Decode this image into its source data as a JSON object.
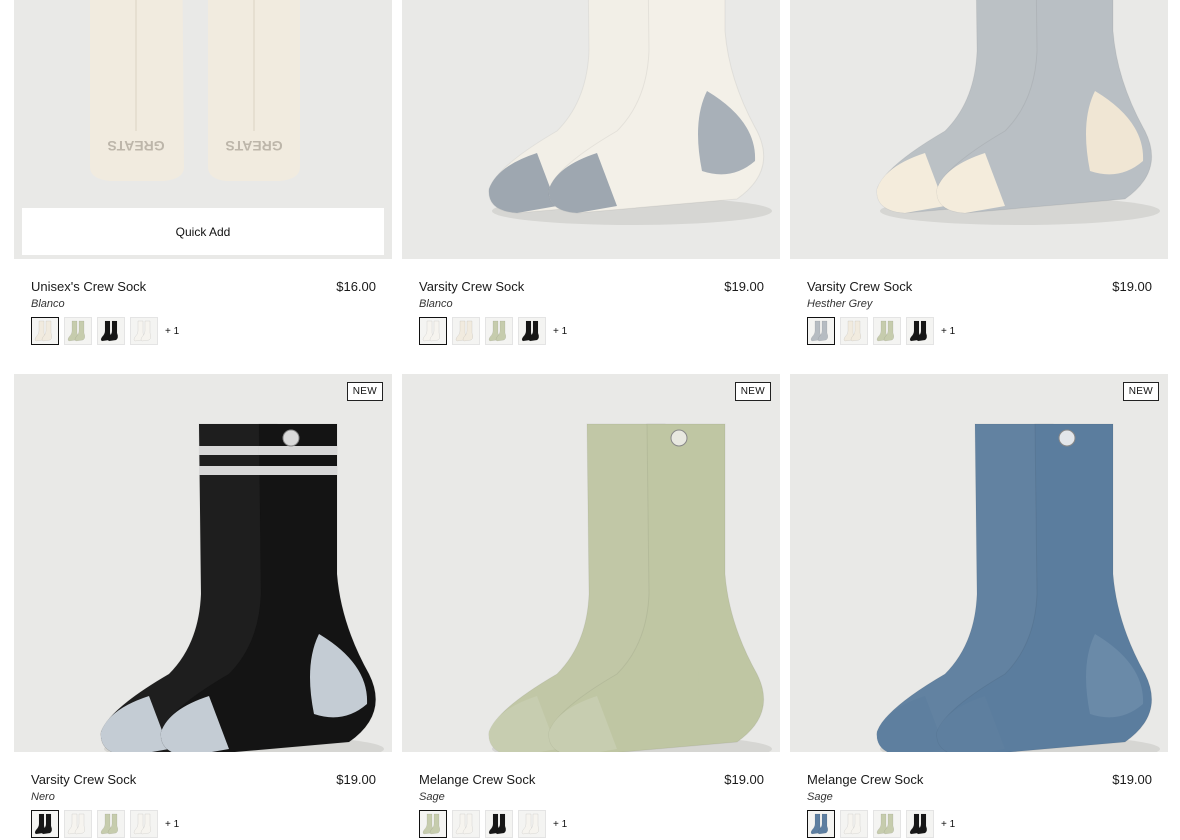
{
  "quick_add_label": "Quick Add",
  "products": [
    {
      "name": "Unisex's Crew Sock",
      "price": "$16.00",
      "variant": "Blanco",
      "badge": "",
      "swatches": [
        "cream",
        "sage",
        "black",
        "white"
      ],
      "more": "+ 1",
      "sock_style": "ankle",
      "colors": {
        "body": "#f1ebdf",
        "heel": "#f1ebdf",
        "toe": "#f1ebdf",
        "stripe": "",
        "logo": "#bdb6aa"
      },
      "logo_text": "GREATS"
    },
    {
      "name": "Varsity Crew Sock",
      "price": "$19.00",
      "variant": "Blanco",
      "badge": "",
      "swatches": [
        "white",
        "cream",
        "sage",
        "black"
      ],
      "more": "+ 1",
      "sock_style": "crew",
      "colors": {
        "body": "#f3f0e8",
        "heel": "#a8b0b8",
        "toe": "#9ea7b0",
        "stripe": "",
        "logo": "#2a3550"
      }
    },
    {
      "name": "Varsity Crew Sock",
      "price": "$19.00",
      "variant": "Hesther Grey",
      "badge": "",
      "swatches": [
        "grey",
        "cream",
        "sage",
        "black"
      ],
      "more": "+ 1",
      "sock_style": "crew",
      "colors": {
        "body": "#b9bfc4",
        "heel": "#f0e6d4",
        "toe": "#f4ecdc",
        "stripe": "",
        "logo": "#1c2740"
      }
    },
    {
      "name": "Varsity Crew Sock",
      "price": "$19.00",
      "variant": "Nero",
      "badge": "NEW",
      "swatches": [
        "black",
        "white",
        "sage",
        "white"
      ],
      "more": "+ 1",
      "sock_style": "crew",
      "colors": {
        "body": "#141414",
        "heel": "#c4ccd4",
        "toe": "#c4ccd4",
        "stripe": "#d8d8d8",
        "logo": "#d9d9d9"
      }
    },
    {
      "name": "Melange Crew Sock",
      "price": "$19.00",
      "variant": "Sage",
      "badge": "NEW",
      "swatches": [
        "sage",
        "white",
        "black",
        "white"
      ],
      "more": "+ 1",
      "sock_style": "crew",
      "colors": {
        "body": "#bfc6a3",
        "heel": "#bfc6a3",
        "toe": "#c7cdb0",
        "stripe": "",
        "logo": "#e8e8e0"
      }
    },
    {
      "name": "Melange Crew Sock",
      "price": "$19.00",
      "variant": "Sage",
      "badge": "NEW",
      "swatches": [
        "blue",
        "white",
        "sage",
        "black"
      ],
      "more": "+ 1",
      "sock_style": "crew",
      "colors": {
        "body": "#5b7d9e",
        "heel": "#6a8aa8",
        "toe": "#5e7f9f",
        "stripe": "",
        "logo": "#e3e6ea"
      }
    }
  ],
  "swatch_colors": {
    "cream": "#f1ebdf",
    "sage": "#c6ccad",
    "black": "#161616",
    "white": "#f6f4ef",
    "grey": "#b6bcc2",
    "blue": "#5d7ea0"
  }
}
